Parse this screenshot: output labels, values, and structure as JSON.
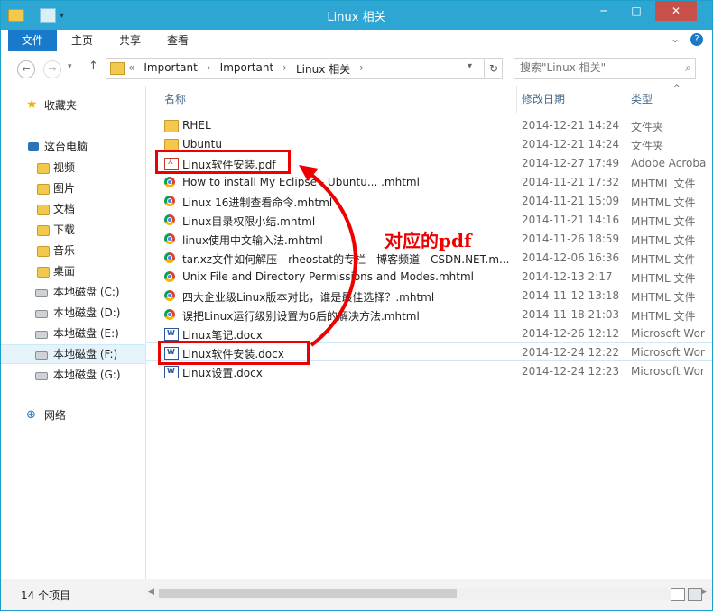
{
  "window": {
    "title": "Linux 相关",
    "controls": {
      "minimize": "─",
      "maximize": "□",
      "close": "✕"
    }
  },
  "quick_access": {
    "caret": "▾"
  },
  "ribbon": {
    "tabs": [
      "文件",
      "主页",
      "共享",
      "查看"
    ],
    "expand_icon": "chevron-down-icon",
    "help_label": "?"
  },
  "address": {
    "overflow": "«",
    "crumbs": [
      "Important",
      "Important",
      "Linux 相关"
    ],
    "separator": "›",
    "dropdown": "▾",
    "refresh": "↻"
  },
  "nav": {
    "back": "←",
    "forward": "→",
    "up": "↑"
  },
  "search": {
    "placeholder": "搜索\"Linux 相关\""
  },
  "sidebar": {
    "favorites": "收藏夹",
    "this_pc": "这台电脑",
    "pc_items": [
      "视频",
      "图片",
      "文档",
      "下载",
      "音乐",
      "桌面"
    ],
    "drives": [
      "本地磁盘 (C:)",
      "本地磁盘 (D:)",
      "本地磁盘 (E:)",
      "本地磁盘 (F:)",
      "本地磁盘 (G:)"
    ],
    "selected_drive": "本地磁盘 (F:)",
    "network": "网络"
  },
  "columns": {
    "name": "名称",
    "modified": "修改日期",
    "type": "类型"
  },
  "files": [
    {
      "name": "RHEL",
      "date": "2014-12-21 14:24",
      "type": "文件夹",
      "icon": "folder-icon"
    },
    {
      "name": "Ubuntu",
      "date": "2014-12-21 14:24",
      "type": "文件夹",
      "icon": "folder-icon"
    },
    {
      "name": "Linux软件安装.pdf",
      "date": "2014-12-27 17:49",
      "type": "Adobe Acroba",
      "icon": "pdf-file-icon"
    },
    {
      "name": "How to install My Eclipse - Ubuntu...  .mhtml",
      "date": "2014-11-21 17:32",
      "type": "MHTML 文件",
      "icon": "chrome-file-icon"
    },
    {
      "name": "Linux 16进制查看命令.mhtml",
      "date": "2014-11-21 15:09",
      "type": "MHTML 文件",
      "icon": "chrome-file-icon"
    },
    {
      "name": "Linux目录权限小结.mhtml",
      "date": "2014-11-21 14:16",
      "type": "MHTML 文件",
      "icon": "chrome-file-icon"
    },
    {
      "name": "linux使用中文输入法.mhtml",
      "date": "2014-11-26 18:59",
      "type": "MHTML 文件",
      "icon": "chrome-file-icon"
    },
    {
      "name": "tar.xz文件如何解压 - rheostat的专栏 - 博客频道 - CSDN.NET.m...",
      "date": "2014-12-06 16:36",
      "type": "MHTML 文件",
      "icon": "chrome-file-icon"
    },
    {
      "name": "Unix File and Directory Permissions and Modes.mhtml",
      "date": "2014-12-13 2:17",
      "type": "MHTML 文件",
      "icon": "chrome-file-icon"
    },
    {
      "name": "四大企业级Linux版本对比，谁是最佳选择？.mhtml",
      "date": "2014-11-12 13:18",
      "type": "MHTML 文件",
      "icon": "chrome-file-icon"
    },
    {
      "name": "误把Linux运行级别设置为6后的解决方法.mhtml",
      "date": "2014-11-18 21:03",
      "type": "MHTML 文件",
      "icon": "chrome-file-icon"
    },
    {
      "name": "Linux笔记.docx",
      "date": "2014-12-26 12:12",
      "type": "Microsoft Wor",
      "icon": "word-file-icon"
    },
    {
      "name": "Linux软件安装.docx",
      "date": "2014-12-24 12:22",
      "type": "Microsoft Wor",
      "icon": "word-file-icon"
    },
    {
      "name": "Linux设置.docx",
      "date": "2014-12-24 12:23",
      "type": "Microsoft Wor",
      "icon": "word-file-icon"
    }
  ],
  "annotation": {
    "text": "对应的pdf",
    "color": "#e00000"
  },
  "status": {
    "count": "14 个项目"
  },
  "colors": {
    "titlebar": "#2ea6d4",
    "file_tab": "#1979ca",
    "selection": "#e5f3fb",
    "close_button": "#c7504a"
  }
}
